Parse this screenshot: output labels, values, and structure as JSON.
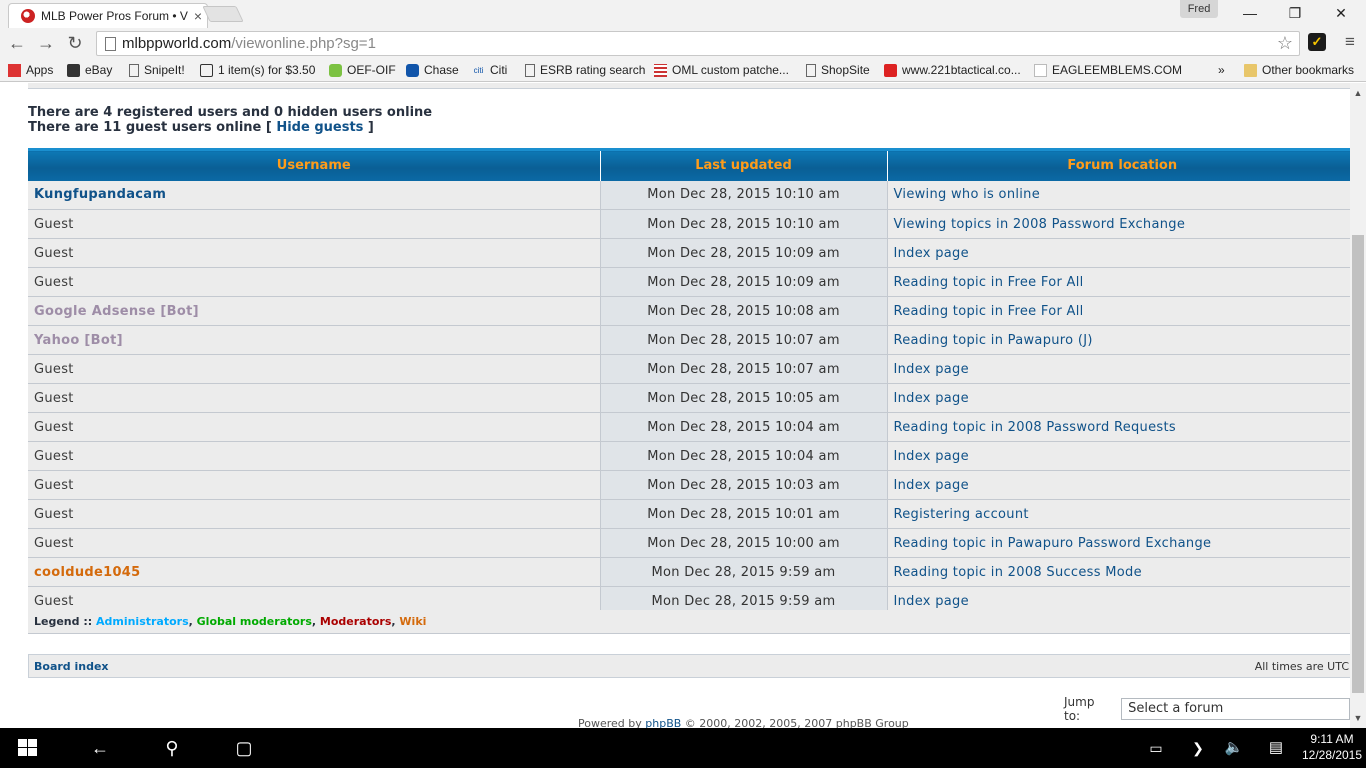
{
  "browser": {
    "tab_title": "MLB Power Pros Forum • V",
    "tab_close": "×",
    "user": "Fred",
    "url_host": "mlbppworld.com",
    "url_path": "/viewonline.php?sg=1",
    "bookmarks": [
      {
        "label": "Apps",
        "icon": "apps-grid-icon"
      },
      {
        "label": "eBay",
        "icon": "shopping-bag-icon"
      },
      {
        "label": "SnipeIt!",
        "icon": "page-icon"
      },
      {
        "label": "1 item(s) for $3.50",
        "icon": "cart-icon"
      },
      {
        "label": "OEF-OIF",
        "icon": "speech-bubble-icon"
      },
      {
        "label": "Chase",
        "icon": "chase-logo-icon"
      },
      {
        "label": "Citi",
        "icon": "citi-logo-icon"
      },
      {
        "label": "ESRB rating search",
        "icon": "page-icon"
      },
      {
        "label": "OML custom patche...",
        "icon": "flag-icon"
      },
      {
        "label": "ShopSite",
        "icon": "page-icon"
      },
      {
        "label": "www.221btactical.co...",
        "icon": "red-logo-icon"
      },
      {
        "label": "EAGLEEMBLEMS.COM",
        "icon": "page-icon"
      }
    ],
    "bookmarks_overflow": "»",
    "other_bookmarks": "Other bookmarks"
  },
  "page": {
    "registered_line": "There are 4 registered users and 0 hidden users online",
    "guest_line_prefix": "There are 11 guest users online [ ",
    "hide_guests": "Hide guests",
    "guest_line_suffix": " ]",
    "table": {
      "headers": [
        "Username",
        "Last updated",
        "Forum location"
      ],
      "rows": [
        {
          "user": "Kungfupandacam",
          "type": "registered",
          "time": "Mon Dec 28, 2015 10:10 am",
          "location": "Viewing who is online"
        },
        {
          "user": "Guest",
          "type": "guest",
          "time": "Mon Dec 28, 2015 10:10 am",
          "location": "Viewing topics in 2008 Password Exchange"
        },
        {
          "user": "Guest",
          "type": "guest",
          "time": "Mon Dec 28, 2015 10:09 am",
          "location": "Index page"
        },
        {
          "user": "Guest",
          "type": "guest",
          "time": "Mon Dec 28, 2015 10:09 am",
          "location": "Reading topic in Free For All"
        },
        {
          "user": "Google Adsense [Bot]",
          "type": "bot",
          "time": "Mon Dec 28, 2015 10:08 am",
          "location": "Reading topic in Free For All"
        },
        {
          "user": "Yahoo [Bot]",
          "type": "bot",
          "time": "Mon Dec 28, 2015 10:07 am",
          "location": "Reading topic in Pawapuro (J)"
        },
        {
          "user": "Guest",
          "type": "guest",
          "time": "Mon Dec 28, 2015 10:07 am",
          "location": "Index page"
        },
        {
          "user": "Guest",
          "type": "guest",
          "time": "Mon Dec 28, 2015 10:05 am",
          "location": "Index page"
        },
        {
          "user": "Guest",
          "type": "guest",
          "time": "Mon Dec 28, 2015 10:04 am",
          "location": "Reading topic in 2008 Password Requests"
        },
        {
          "user": "Guest",
          "type": "guest",
          "time": "Mon Dec 28, 2015 10:04 am",
          "location": "Index page"
        },
        {
          "user": "Guest",
          "type": "guest",
          "time": "Mon Dec 28, 2015 10:03 am",
          "location": "Index page"
        },
        {
          "user": "Guest",
          "type": "guest",
          "time": "Mon Dec 28, 2015 10:01 am",
          "location": "Registering account"
        },
        {
          "user": "Guest",
          "type": "guest",
          "time": "Mon Dec 28, 2015 10:00 am",
          "location": "Reading topic in Pawapuro Password Exchange"
        },
        {
          "user": "cooldude1045",
          "type": "wiki",
          "time": "Mon Dec 28, 2015 9:59 am",
          "location": "Reading topic in 2008 Success Mode"
        },
        {
          "user": "Guest",
          "type": "guest",
          "time": "Mon Dec 28, 2015 9:59 am",
          "location": "Index page"
        }
      ]
    },
    "legend": {
      "label": "Legend :: ",
      "groups": [
        "Administrators",
        "Global moderators",
        "Moderators",
        "Wiki"
      ],
      "separator": ", "
    },
    "board_index": "Board index",
    "timezone": "All times are UTC",
    "jump_to": "Jump to:",
    "jump_select": "Select a forum",
    "footer_prefix": "Powered by ",
    "footer_link": "phpBB",
    "footer_suffix": " © 2000, 2002, 2005, 2007 phpBB Group"
  },
  "taskbar": {
    "time": "9:11 AM",
    "date": "12/28/2015"
  },
  "colors": {
    "header_bg": "#0a5f95",
    "header_text": "#ff9c1a",
    "link": "#105289",
    "bot": "#9e8da7",
    "wiki": "#d46a0c",
    "admin": "#00aaff",
    "global_mod": "#00aa00",
    "moderator": "#aa0000"
  }
}
